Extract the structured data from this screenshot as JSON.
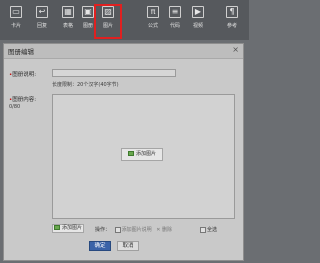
{
  "toolbar": {
    "items": [
      {
        "label": "卡片",
        "icon": "card-icon",
        "glyph": "▭"
      },
      {
        "label": "回复",
        "icon": "reply-icon",
        "glyph": "↩"
      },
      {
        "label": "表格",
        "icon": "table-icon",
        "glyph": "▦"
      },
      {
        "label": "图册",
        "icon": "album-icon",
        "glyph": "▣"
      },
      {
        "label": "图片",
        "icon": "image-icon",
        "glyph": "▨"
      },
      {
        "label": "公式",
        "icon": "formula-icon",
        "glyph": "π"
      },
      {
        "label": "代码",
        "icon": "code-icon",
        "glyph": "≡"
      },
      {
        "label": "视频",
        "icon": "video-icon",
        "glyph": "▶"
      },
      {
        "label": "参考",
        "icon": "reference-icon",
        "glyph": "¶"
      }
    ]
  },
  "dialog": {
    "title": "图册编辑",
    "close": "×",
    "desc_label": "图册说明:",
    "desc_value": "",
    "length_hint": "长度限制：20个汉字(40字节)",
    "content_label": "图册内容:",
    "content_count": "0/80",
    "add_image": "添加图片",
    "add_image_bottom": "添加图片",
    "ops_label": "操作：",
    "op_add_desc": "添加图片说明",
    "op_delete": "删除",
    "select_all": "全选",
    "ok": "确定",
    "cancel": "取消"
  },
  "colors": {
    "highlight": "#e02020",
    "primary": "#3a63a8",
    "required": "#c00000"
  }
}
